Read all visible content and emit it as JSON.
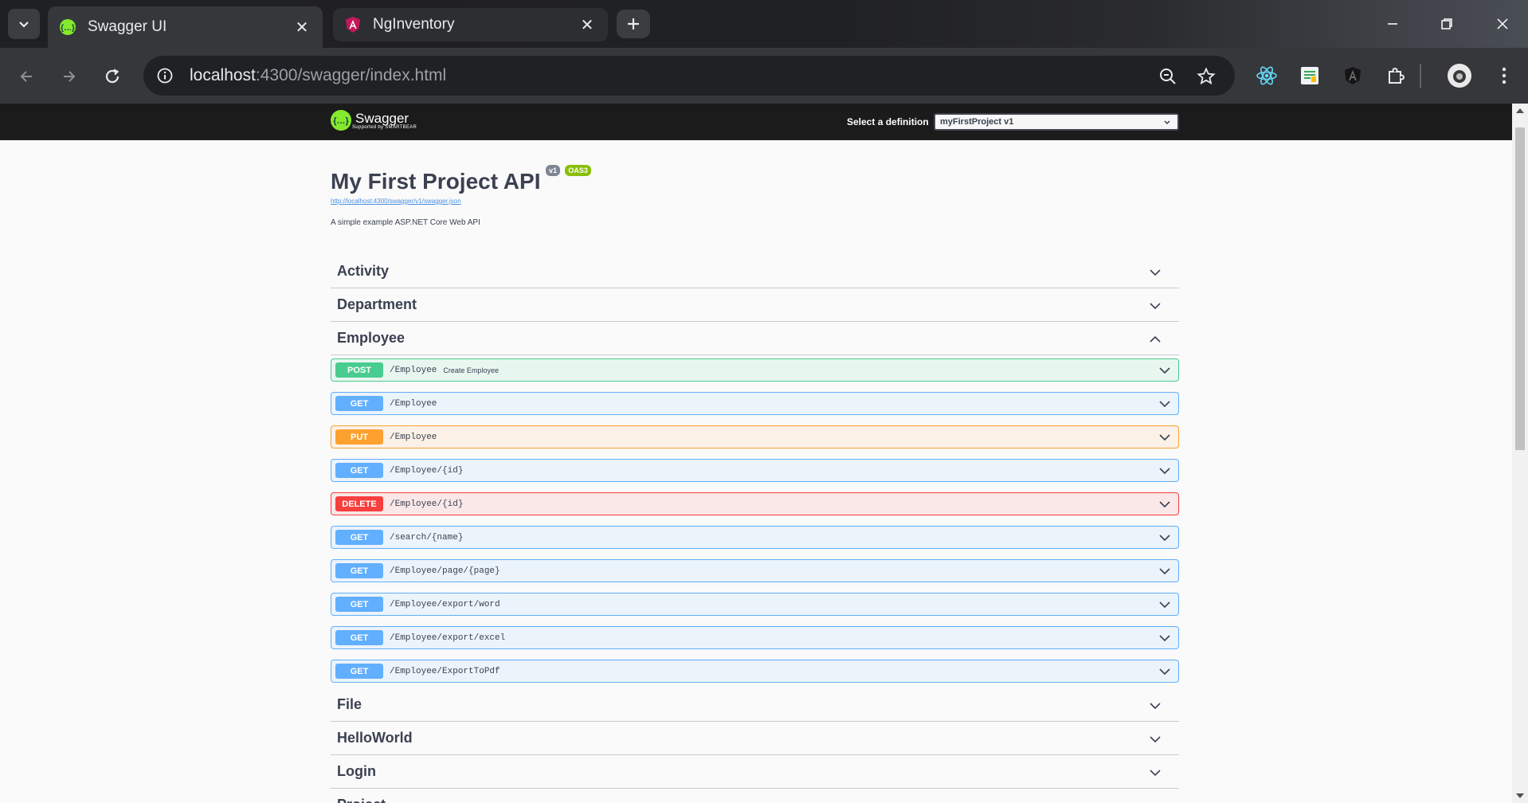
{
  "browser": {
    "tabs": [
      {
        "title": "Swagger UI",
        "active": true
      },
      {
        "title": "NgInventory",
        "active": false
      }
    ],
    "url_host": "localhost",
    "url_path": ":4300/swagger/index.html"
  },
  "swagger": {
    "logo_text": "Swagger",
    "logo_sub": "Supported by SMARTBEAR",
    "definition_label": "Select a definition",
    "definition_value": "myFirstProject v1",
    "title": "My First Project API",
    "version_badge": "v1",
    "oas_badge": "OAS3",
    "spec_link": "http://localhost:4300/swagger/v1/swagger.json",
    "description": "A simple example ASP.NET Core Web API",
    "tags": [
      {
        "name": "Activity",
        "expanded": false
      },
      {
        "name": "Department",
        "expanded": false
      },
      {
        "name": "Employee",
        "expanded": true
      },
      {
        "name": "File",
        "expanded": false
      },
      {
        "name": "HelloWorld",
        "expanded": false
      },
      {
        "name": "Login",
        "expanded": false
      },
      {
        "name": "Project",
        "expanded": false
      }
    ],
    "operations": [
      {
        "method": "POST",
        "path": "/Employee",
        "summary": "Create Employee"
      },
      {
        "method": "GET",
        "path": "/Employee",
        "summary": ""
      },
      {
        "method": "PUT",
        "path": "/Employee",
        "summary": ""
      },
      {
        "method": "GET",
        "path": "/Employee/{id}",
        "summary": ""
      },
      {
        "method": "DELETE",
        "path": "/Employee/{id}",
        "summary": ""
      },
      {
        "method": "GET",
        "path": "/search/{name}",
        "summary": ""
      },
      {
        "method": "GET",
        "path": "/Employee/page/{page}",
        "summary": ""
      },
      {
        "method": "GET",
        "path": "/Employee/export/word",
        "summary": ""
      },
      {
        "method": "GET",
        "path": "/Employee/export/excel",
        "summary": ""
      },
      {
        "method": "GET",
        "path": "/Employee/ExportToPdf",
        "summary": ""
      }
    ]
  },
  "colors": {
    "post": "#49cc90",
    "get": "#61affe",
    "put": "#fca130",
    "delete": "#f93e3e",
    "swagger_green": "#85ea2d"
  }
}
